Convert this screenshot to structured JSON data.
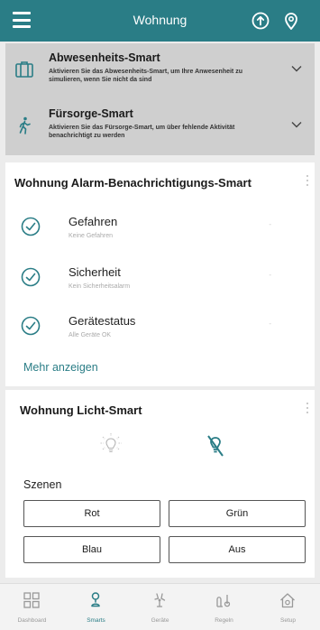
{
  "header": {
    "title": "Wohnung",
    "menu_icon": "hamburger-menu-icon",
    "info_icon": "up-arrow-circle-icon",
    "location_icon": "location-pin-icon",
    "color": "#2a7d86"
  },
  "modes": [
    {
      "title": "Abwesenheits-Smart",
      "description": "Aktivieren Sie das Abwesenheits-Smart, um Ihre Anwesenheit zu simulieren, wenn Sie nicht da sind",
      "icon": "suitcase-icon"
    },
    {
      "title": "Fürsorge-Smart",
      "description": "Aktivieren Sie das Fürsorge-Smart, um über fehlende Aktivität benachrichtigt zu werden",
      "icon": "walking-person-icon"
    }
  ],
  "alarm": {
    "title": "Wohnung Alarm-Benachrichtigungs-Smart",
    "items": [
      {
        "label": "Gefahren",
        "sub": "Keine Gefahren",
        "dash": "-"
      },
      {
        "label": "Sicherheit",
        "sub": "Kein Sicherheitsalarm",
        "dash": "-"
      },
      {
        "label": "Gerätestatus",
        "sub": "Alle Geräte OK",
        "dash": "-"
      }
    ],
    "more": "Mehr anzeigen"
  },
  "light": {
    "title": "Wohnung Licht-Smart",
    "scenes_label": "Szenen",
    "scenes": [
      "Rot",
      "Grün",
      "Blau",
      "Aus"
    ]
  },
  "nav": [
    {
      "label": "Dashboard",
      "icon": "dashboard-grid-icon"
    },
    {
      "label": "Smarts",
      "icon": "smarts-icon",
      "active": true
    },
    {
      "label": "Geräte",
      "icon": "devices-icon"
    },
    {
      "label": "Regeln",
      "icon": "rules-icon"
    },
    {
      "label": "Setup",
      "icon": "house-setup-icon"
    }
  ]
}
